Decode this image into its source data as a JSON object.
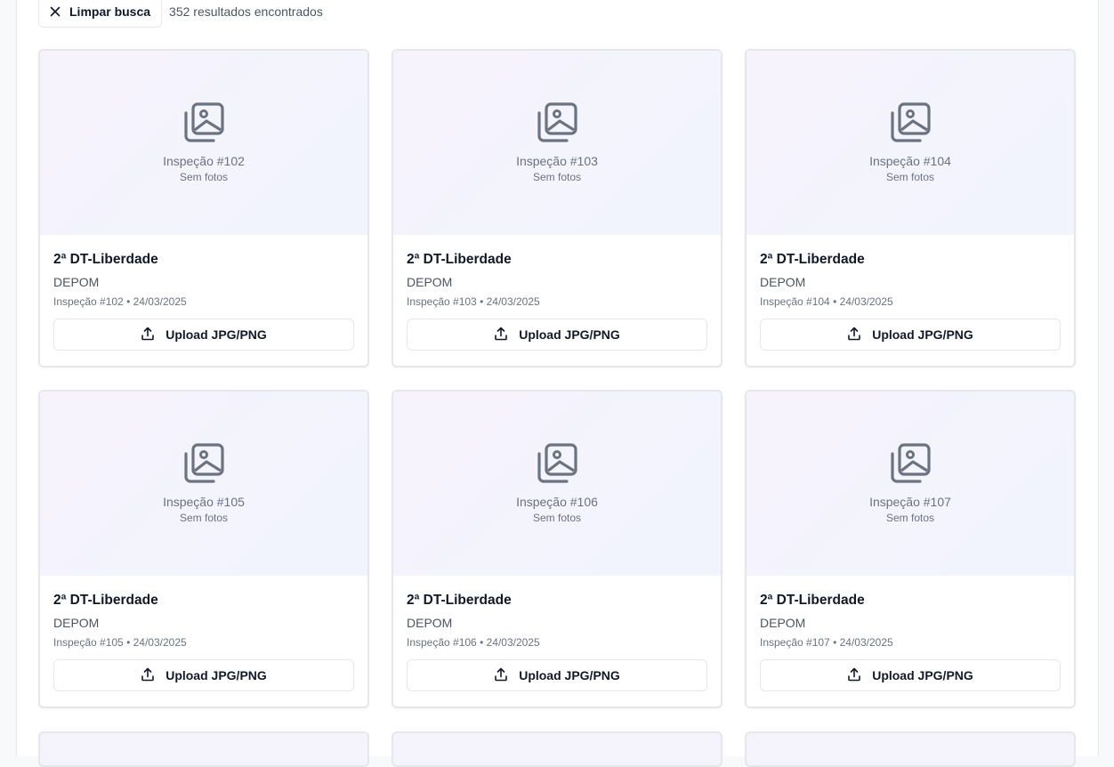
{
  "toolbar": {
    "clear_label": "Limpar busca",
    "result_count": "352 resultados encontrados"
  },
  "cards": [
    {
      "thumb_title": "Inspeção #102",
      "thumb_sub": "Sem fotos",
      "title": "2ª DT-Liberdade",
      "org": "DEPOM",
      "meta": "Inspeção #102 • 24/03/2025",
      "upload_label": "Upload JPG/PNG"
    },
    {
      "thumb_title": "Inspeção #103",
      "thumb_sub": "Sem fotos",
      "title": "2ª DT-Liberdade",
      "org": "DEPOM",
      "meta": "Inspeção #103 • 24/03/2025",
      "upload_label": "Upload JPG/PNG"
    },
    {
      "thumb_title": "Inspeção #104",
      "thumb_sub": "Sem fotos",
      "title": "2ª DT-Liberdade",
      "org": "DEPOM",
      "meta": "Inspeção #104 • 24/03/2025",
      "upload_label": "Upload JPG/PNG"
    },
    {
      "thumb_title": "Inspeção #105",
      "thumb_sub": "Sem fotos",
      "title": "2ª DT-Liberdade",
      "org": "DEPOM",
      "meta": "Inspeção #105 • 24/03/2025",
      "upload_label": "Upload JPG/PNG"
    },
    {
      "thumb_title": "Inspeção #106",
      "thumb_sub": "Sem fotos",
      "title": "2ª DT-Liberdade",
      "org": "DEPOM",
      "meta": "Inspeção #106 • 24/03/2025",
      "upload_label": "Upload JPG/PNG"
    },
    {
      "thumb_title": "Inspeção #107",
      "thumb_sub": "Sem fotos",
      "title": "2ª DT-Liberdade",
      "org": "DEPOM",
      "meta": "Inspeção #107 • 24/03/2025",
      "upload_label": "Upload JPG/PNG"
    }
  ],
  "icons": {
    "clear": "close-icon",
    "placeholder": "images-icon",
    "upload": "upload-icon"
  }
}
